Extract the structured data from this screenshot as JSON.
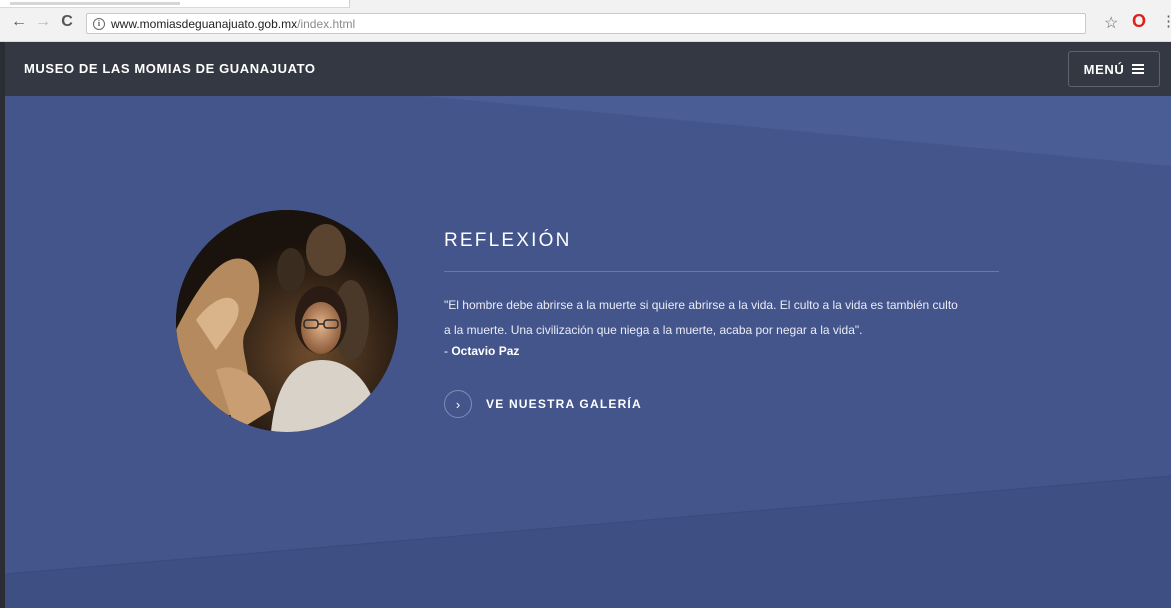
{
  "browser": {
    "url_domain": "www.momiasdeguanajuato.gob.mx",
    "url_path": "/index.html",
    "back_icon": "←",
    "forward_icon": "→",
    "reload_icon": "C",
    "info_icon": "i",
    "star_icon": "☆",
    "opera_icon": "O",
    "more_icon": "⋮"
  },
  "header": {
    "site_title": "MUSEO DE LAS MOMIAS DE GUANAJUATO",
    "menu_label": "MENÚ"
  },
  "main": {
    "heading": "REFLEXIÓN",
    "quote_line1": "\"El hombre debe abrirse a la muerte si quiere abrirse a la vida. El culto a la vida es también culto",
    "quote_line2": "a la muerte. Una civilización que niega a la muerte, acaba por negar a la vida\".",
    "author_prefix": "- ",
    "author_name": "Octavio Paz",
    "cta_icon": "›",
    "cta_label": "VE NUESTRA GALERÍA"
  },
  "colors": {
    "hero_bg": "#44558c",
    "header_bg": "#343842",
    "accent_line": "#6a78a6"
  }
}
